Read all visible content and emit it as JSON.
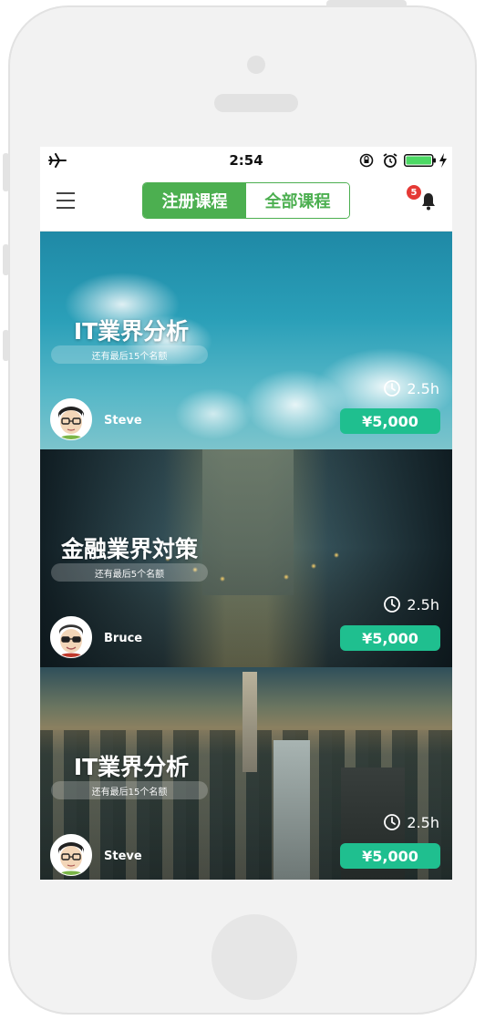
{
  "status_bar": {
    "time": "2:54",
    "airplane_mode": true,
    "battery_color": "#4cd964"
  },
  "nav": {
    "tabs": [
      {
        "label": "注册课程",
        "active": true
      },
      {
        "label": "全部课程",
        "active": false
      }
    ],
    "notification_count": "5"
  },
  "colors": {
    "accent": "#4caf50",
    "price": "#1fbf8f",
    "badge": "#e53935"
  },
  "courses": [
    {
      "title": "IT業界分析",
      "seats_text": "还有最后15个名额",
      "teacher": "Steve",
      "duration": "2.5h",
      "price": "¥5,000",
      "background": "sky"
    },
    {
      "title": "金融業界対策",
      "seats_text": "还有最后5个名额",
      "teacher": "Bruce",
      "duration": "2.5h",
      "price": "¥5,000",
      "background": "street"
    },
    {
      "title": "IT業界分析",
      "seats_text": "还有最后15个名额",
      "teacher": "Steve",
      "duration": "2.5h",
      "price": "¥5,000",
      "background": "city"
    }
  ]
}
